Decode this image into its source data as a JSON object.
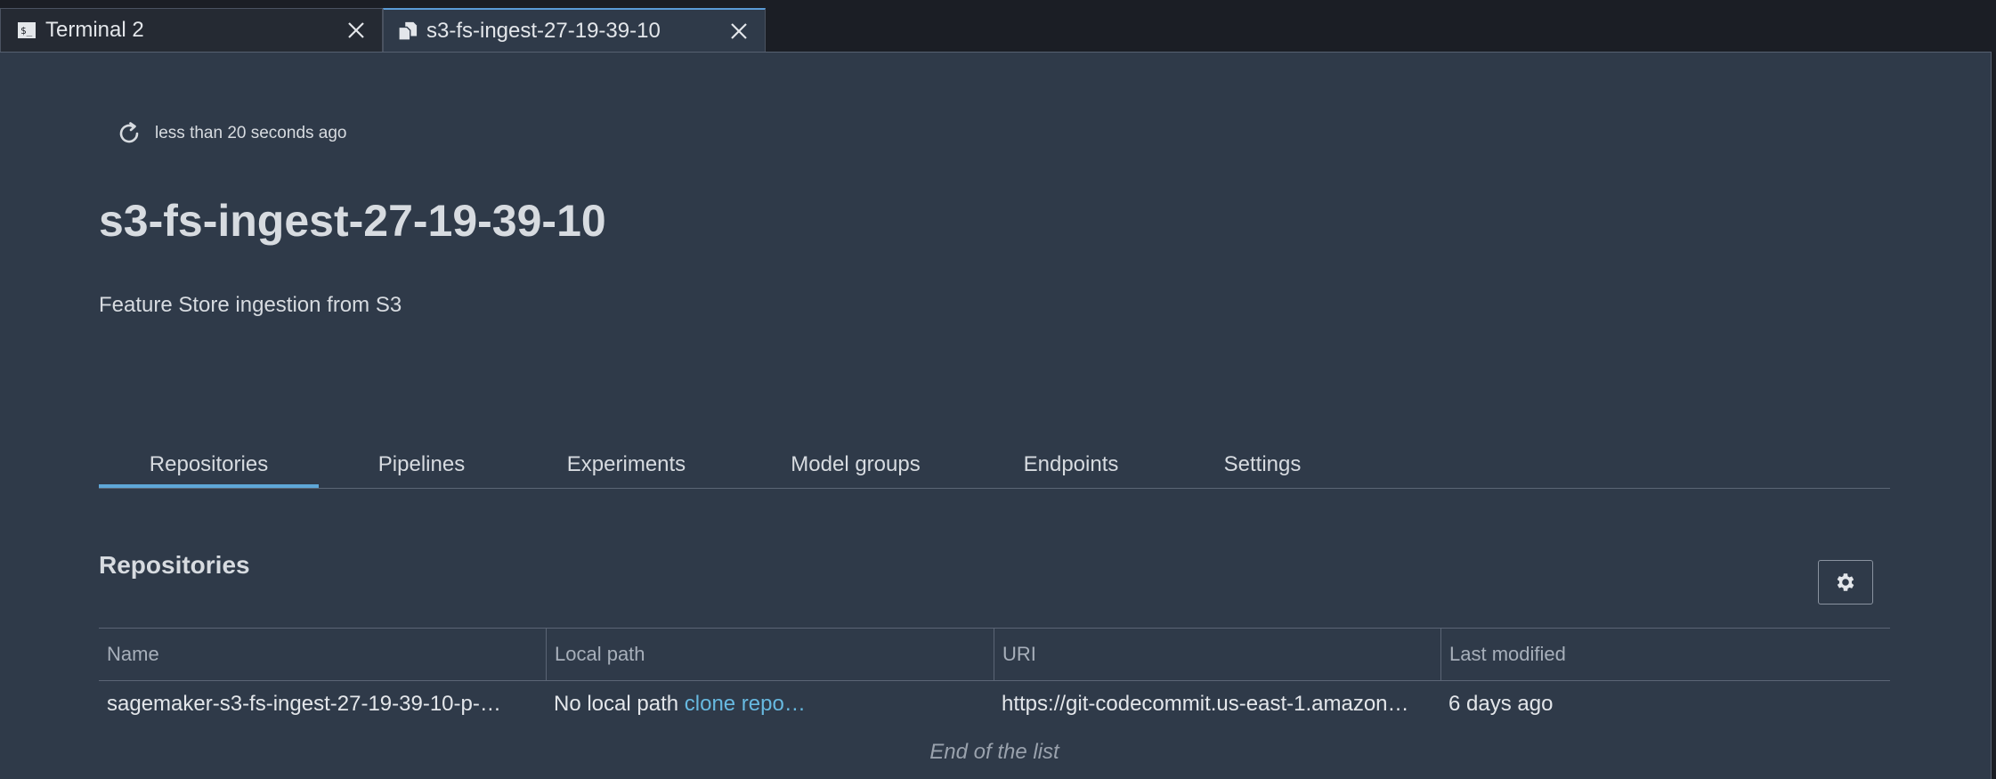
{
  "tabs": [
    {
      "label": "Terminal 2",
      "icon": "terminal-icon"
    },
    {
      "label": "s3-fs-ingest-27-19-39-10",
      "icon": "document-icon"
    }
  ],
  "refresh": {
    "text": "less than 20 seconds ago"
  },
  "project": {
    "title": "s3-fs-ingest-27-19-39-10",
    "description": "Feature Store ingestion from S3"
  },
  "subtabs": [
    "Repositories",
    "Pipelines",
    "Experiments",
    "Model groups",
    "Endpoints",
    "Settings"
  ],
  "section": {
    "title": "Repositories"
  },
  "table": {
    "columns": [
      "Name",
      "Local path",
      "URI",
      "Last modified"
    ],
    "rows": [
      {
        "name": "sagemaker-s3-fs-ingest-27-19-39-10-p-…",
        "local_path": "No local path",
        "clone_link": "clone repo…",
        "uri": "https://git-codecommit.us-east-1.amazon…",
        "last_modified": "6 days ago"
      }
    ],
    "end_text": "End of the list"
  },
  "colors": {
    "background": "#2f3a49",
    "accent": "#5ea7d8",
    "link": "#67b9e0"
  }
}
